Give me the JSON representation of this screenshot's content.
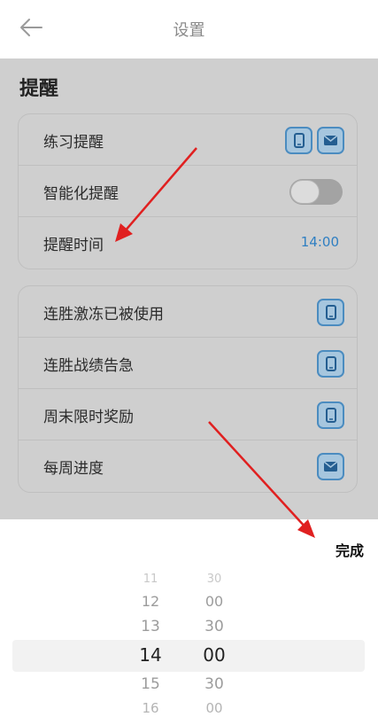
{
  "header": {
    "title": "设置",
    "back_icon": "back-arrow-icon"
  },
  "reminder": {
    "section_title": "提醒"
  },
  "group1": [
    {
      "label": "练习提醒",
      "icons": [
        "phone-icon",
        "mail-icon"
      ]
    },
    {
      "label": "智能化提醒",
      "toggle": "off"
    },
    {
      "label": "提醒时间",
      "value": "14:00"
    }
  ],
  "group2": [
    {
      "label": "连胜激冻已被使用",
      "icon": "phone-icon"
    },
    {
      "label": "连胜战绩告急",
      "icon": "phone-icon"
    },
    {
      "label": "周末限时奖励",
      "icon": "phone-icon"
    },
    {
      "label": "每周进度",
      "icon": "mail-icon"
    }
  ],
  "picker": {
    "done_label": "完成",
    "rows": [
      {
        "h": "11",
        "m": "30"
      },
      {
        "h": "12",
        "m": "00"
      },
      {
        "h": "13",
        "m": "30"
      },
      {
        "h": "14",
        "m": "00"
      },
      {
        "h": "15",
        "m": "30"
      },
      {
        "h": "16",
        "m": "00"
      }
    ]
  },
  "colors": {
    "accent": "#2f7fc2",
    "arrow": "#e02020",
    "overlay": "#cfcfcf"
  }
}
